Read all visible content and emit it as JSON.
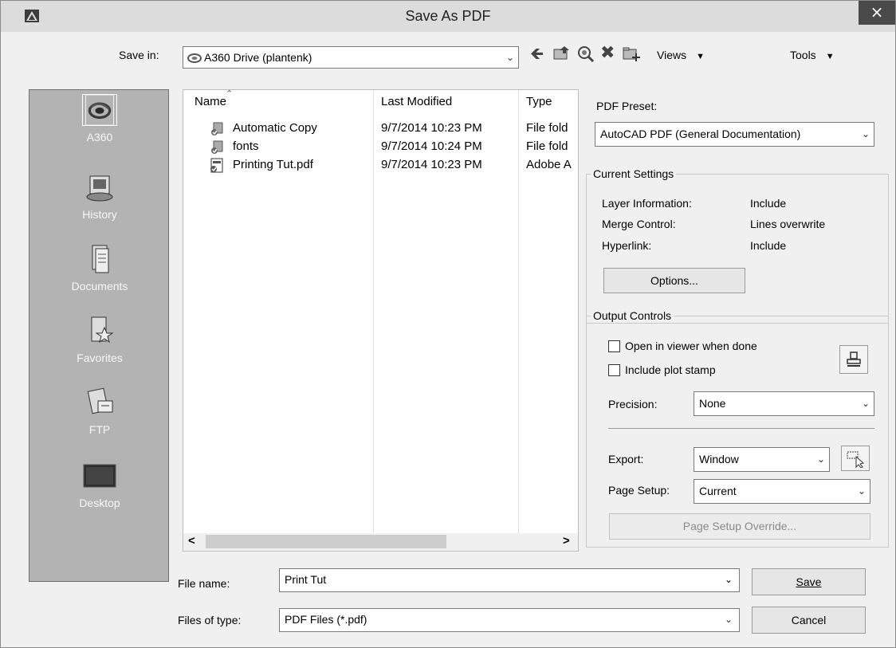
{
  "window": {
    "title": "Save As PDF",
    "close_glyph": "×"
  },
  "save_in": {
    "label": "Save in:",
    "value": "A360 Drive (plantenk)"
  },
  "toolbar": {
    "views_label": "Views",
    "tools_label": "Tools"
  },
  "places": [
    {
      "name": "A360",
      "icon": "a360-icon"
    },
    {
      "name": "History",
      "icon": "history-icon"
    },
    {
      "name": "Documents",
      "icon": "documents-icon"
    },
    {
      "name": "Favorites",
      "icon": "favorites-icon"
    },
    {
      "name": "FTP",
      "icon": "ftp-icon"
    },
    {
      "name": "Desktop",
      "icon": "desktop-icon"
    }
  ],
  "file_list": {
    "columns": [
      "Name",
      "Last Modified",
      "Type"
    ],
    "rows": [
      {
        "name": "Automatic Copy",
        "modified": "9/7/2014 10:23 PM",
        "type": "File fold",
        "icon": "folder-icon"
      },
      {
        "name": "fonts",
        "modified": "9/7/2014 10:24 PM",
        "type": "File fold",
        "icon": "folder-icon"
      },
      {
        "name": "Printing Tut.pdf",
        "modified": "9/7/2014 10:23 PM",
        "type": "Adobe A",
        "icon": "pdf-file-icon"
      }
    ],
    "scroll_left": "<",
    "scroll_right": ">"
  },
  "pdf_preset": {
    "label": "PDF Preset:",
    "value": "AutoCAD PDF (General Documentation)"
  },
  "current_settings": {
    "title": "Current Settings",
    "items": [
      {
        "key": "Layer Information:",
        "value": "Include"
      },
      {
        "key": "Merge Control:",
        "value": "Lines overwrite"
      },
      {
        "key": "Hyperlink:",
        "value": "Include"
      }
    ],
    "options_button": "Options..."
  },
  "output_controls": {
    "title": "Output Controls",
    "open_in_viewer": "Open in viewer when done",
    "include_plot_stamp": "Include plot stamp",
    "precision_label": "Precision:",
    "precision_value": "None",
    "export_label": "Export:",
    "export_value": "Window",
    "page_setup_label": "Page Setup:",
    "page_setup_value": "Current",
    "page_setup_override": "Page Setup Override..."
  },
  "file_name": {
    "label": "File name:",
    "value": "Print Tut"
  },
  "files_of_type": {
    "label": "Files of type:",
    "value": "PDF Files (*.pdf)"
  },
  "buttons": {
    "save": "Save",
    "cancel": "Cancel"
  }
}
